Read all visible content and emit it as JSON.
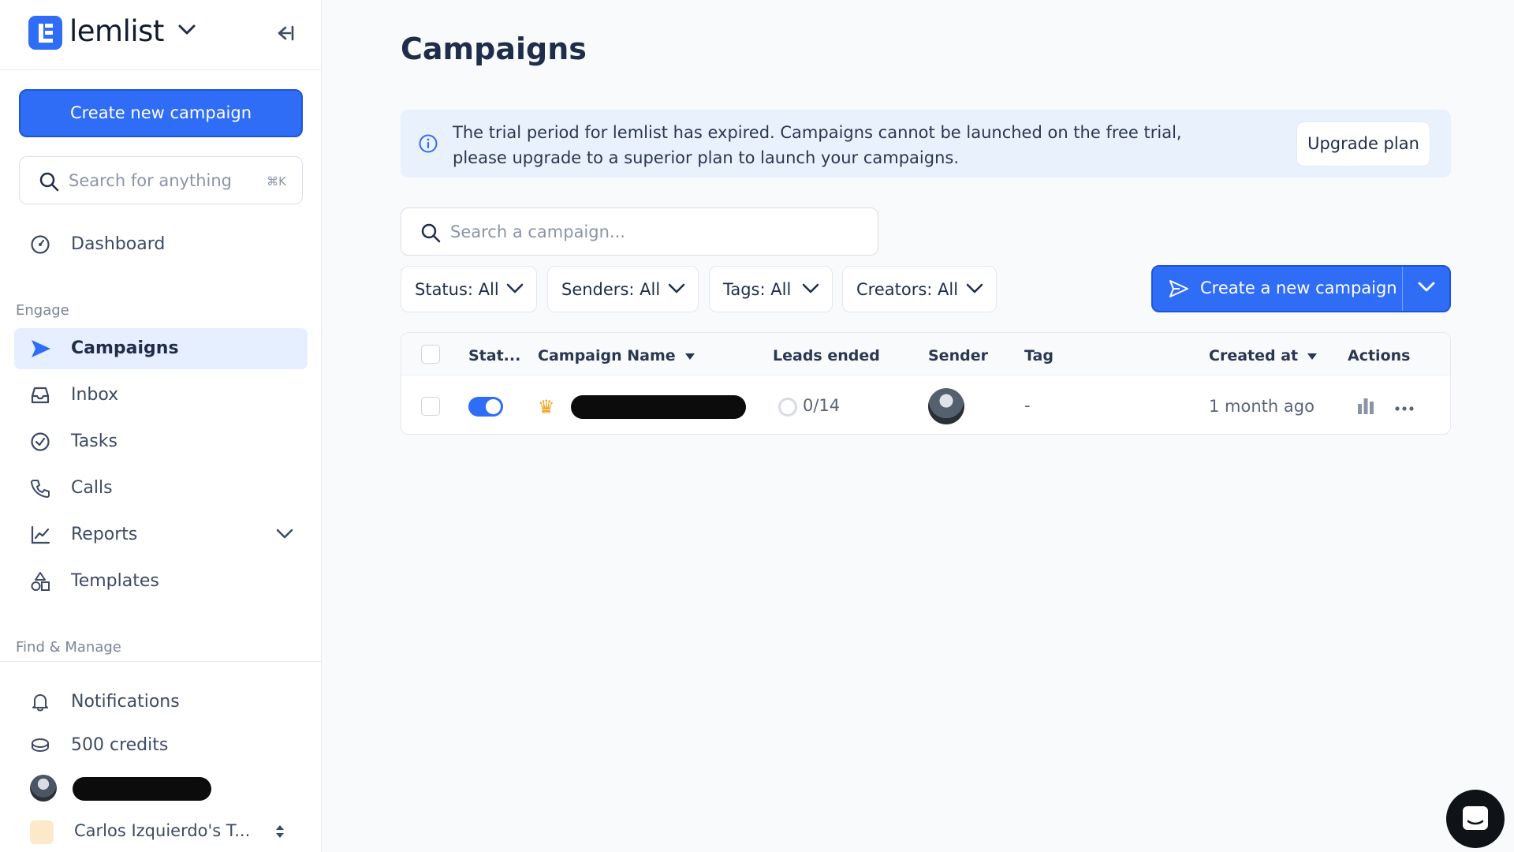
{
  "brand": {
    "name": "lemlist"
  },
  "sidebar": {
    "create_button": "Create new campaign",
    "search_placeholder": "Search for anything",
    "search_shortcut": "⌘K",
    "dashboard": "Dashboard",
    "section_engage": "Engage",
    "items": [
      {
        "label": "Campaigns",
        "icon": "send-icon",
        "active": true
      },
      {
        "label": "Inbox",
        "icon": "inbox-icon"
      },
      {
        "label": "Tasks",
        "icon": "check-circle-icon"
      },
      {
        "label": "Calls",
        "icon": "phone-icon"
      },
      {
        "label": "Reports",
        "icon": "chart-line-icon"
      },
      {
        "label": "Templates",
        "icon": "shapes-icon"
      }
    ],
    "section_find": "Find & Manage",
    "notifications": "Notifications",
    "credits": "500 credits",
    "team": "Carlos Izquierdo's T..."
  },
  "main": {
    "title": "Campaigns",
    "banner": {
      "message": "The trial period for lemlist has expired. Campaigns cannot be launched on the free trial, please upgrade to a superior plan to launch your campaigns.",
      "button": "Upgrade plan"
    },
    "search_placeholder": "Search a campaign...",
    "filters": [
      "Status: All",
      "Senders: All",
      "Tags: All",
      "Creators: All"
    ],
    "new_campaign_button": "Create a new campaign",
    "table": {
      "headers": [
        "Stat...",
        "Campaign Name",
        "Leads ended",
        "Sender",
        "Tag",
        "Created at",
        "Actions"
      ],
      "rows": [
        {
          "status_on": true,
          "leads_ended": "0/14",
          "tag": "-",
          "created_at": "1 month ago"
        }
      ]
    }
  },
  "colors": {
    "accent": "#2f6df6",
    "active_bg": "#e6efff",
    "banner_bg": "#e9f1fd"
  }
}
